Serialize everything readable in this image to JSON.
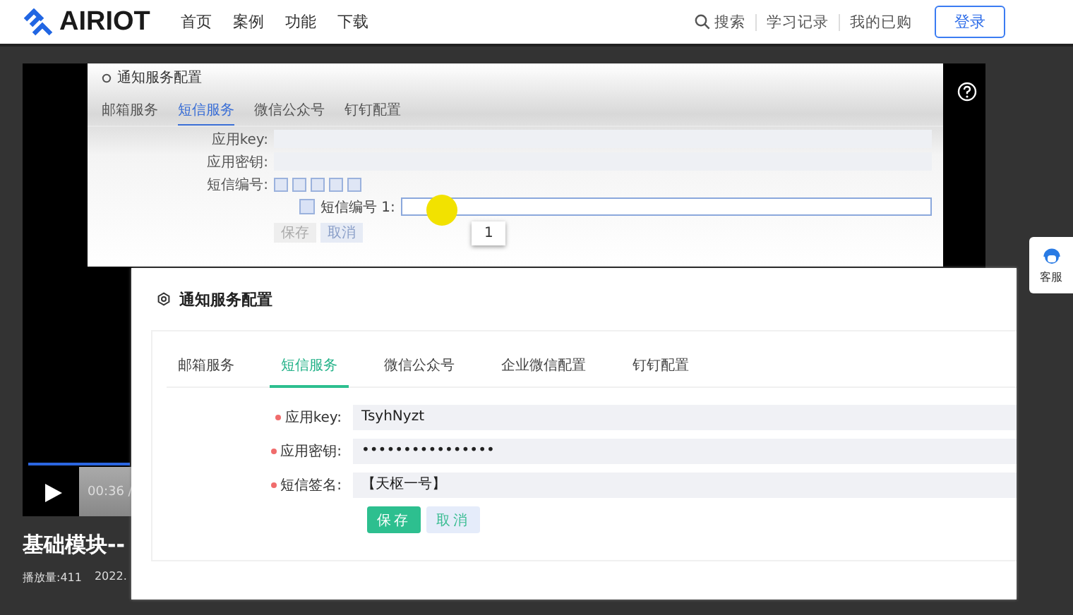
{
  "header": {
    "logo": "AIRIOT",
    "nav": [
      {
        "label": "首页"
      },
      {
        "label": "案例"
      },
      {
        "label": "功能"
      },
      {
        "label": "下载"
      }
    ],
    "search": "搜索",
    "links": [
      "学习记录",
      "我的已购"
    ],
    "login": "登录"
  },
  "video": {
    "frame": {
      "title": "通知服务配置",
      "tabs": [
        {
          "label": "邮箱服务",
          "selected": false
        },
        {
          "label": "短信服务",
          "selected": true
        },
        {
          "label": "微信公众号",
          "selected": false
        },
        {
          "label": "钉钉配置",
          "selected": false
        }
      ],
      "fields": [
        {
          "label": "应用key:"
        },
        {
          "label": "应用密钥:"
        },
        {
          "label": "短信编号:"
        }
      ],
      "sms_item_label": "短信编号 1:",
      "buttons": [
        "保存",
        "取消"
      ],
      "dropdown_option": "1"
    },
    "time": "00:36 /",
    "title": "基础模块--",
    "plays": "播放量:411",
    "date": "2022."
  },
  "overlay": {
    "title": "通知服务配置",
    "tabs": [
      {
        "label": "邮箱服务",
        "selected": false
      },
      {
        "label": "短信服务",
        "selected": true
      },
      {
        "label": "微信公众号",
        "selected": false
      },
      {
        "label": "企业微信配置",
        "selected": false
      },
      {
        "label": "钉钉配置",
        "selected": false
      }
    ],
    "fields": [
      {
        "label": "应用key:",
        "value": "TsyhNyzt",
        "required": true
      },
      {
        "label": "应用密钥:",
        "value": "••••••••••••••••",
        "required": true
      },
      {
        "label": "短信签名:",
        "value": "【天枢一号】",
        "required": true
      }
    ],
    "buttons": [
      {
        "label": "保存",
        "kind": "primary"
      },
      {
        "label": "取消",
        "kind": "secondary"
      }
    ]
  },
  "service": {
    "label": "客服"
  }
}
